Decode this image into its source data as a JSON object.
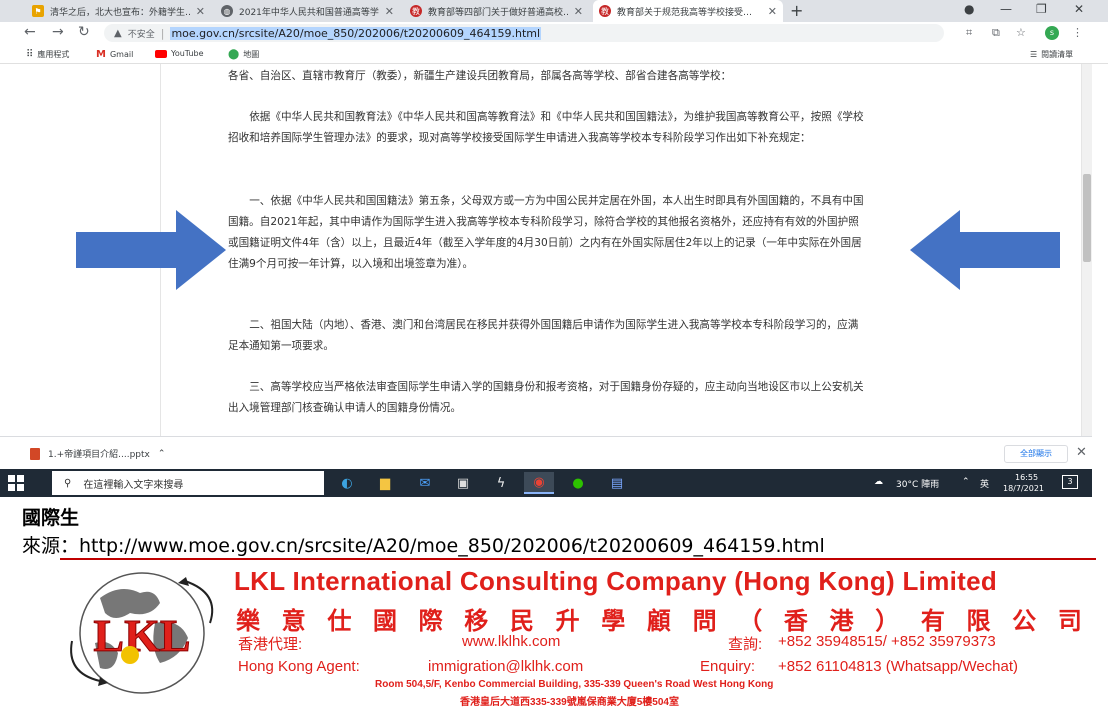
{
  "browser": {
    "tabs": [
      {
        "title": "清华之后，北大也宣布：外籍学生…",
        "favicon": "yellow-flag-icon",
        "active": false
      },
      {
        "title": "2021年中华人民共和国普通高等学…",
        "favicon": "globe-icon",
        "active": false
      },
      {
        "title": "教育部等四部门关于做好普通高校…",
        "favicon": "moe-emblem-icon",
        "active": false
      },
      {
        "title": "教育部关于规范我高等学校接受…",
        "favicon": "moe-emblem-icon",
        "active": true
      }
    ],
    "security_label": "不安全",
    "url": "moe.gov.cn/srcsite/A20/moe_850/202006/t20200609_464159.html",
    "profile_initial": "s",
    "bookmarks": [
      {
        "label": "應用程式",
        "icon": "apps-grid-icon"
      },
      {
        "label": "Gmail",
        "icon": "gmail-icon"
      },
      {
        "label": "YouTube",
        "icon": "youtube-icon"
      },
      {
        "label": "地圖",
        "icon": "maps-pin-icon"
      }
    ],
    "reading_list": "閱讀清單"
  },
  "page": {
    "paragraphs": [
      "各省、自治区、直辖市教育厅（教委），新疆生产建设兵团教育局，部属各高等学校、部省合建各高等学校：",
      "依据《中华人民共和国教育法》《中华人民共和国高等教育法》和《中华人民共和国国籍法》，为维护我国高等教育公平，按照《学校招收和培养国际学生管理办法》的要求，现对高等学校接受国际学生申请进入我高等学校本专科阶段学习作出如下补充规定：",
      "一、依据《中华人民共和国国籍法》第五条，父母双方或一方为中国公民并定居在外国，本人出生时即具有外国国籍的，不具有中国国籍。自2021年起，其中申请作为国际学生进入我高等学校本专科阶段学习，除符合学校的其他报名资格外，还应持有有效的外国护照或国籍证明文件4年（含）以上，且最近4年（截至入学年度的4月30日前）之内有在外国实际居住2年以上的记录（一年中实际在外国居住满9个月可按一年计算，以入境和出境签章为准）。",
      "二、祖国大陆（内地）、香港、澳门和台湾居民在移民并获得外国国籍后申请作为国际学生进入我高等学校本专科阶段学习的，应满足本通知第一项要求。",
      "三、高等学校应当严格依法审查国际学生申请入学的国籍身份和报考资格，对于国籍身份存疑的，应主动向当地设区市以上公安机关出入境管理部门核查确认申请人的国籍身份情况。"
    ]
  },
  "download_bar": {
    "file_name": "1.+帝謹項目介紹....pptx",
    "show_all": "全部顯示"
  },
  "taskbar": {
    "search_placeholder": "在這裡輸入文字來搜尋",
    "weather": "30°C 陣雨",
    "ime": "英",
    "time": "16:55",
    "date": "18/7/2021",
    "notifications": "3"
  },
  "caption": {
    "title": "國際生",
    "source_label": "來源：",
    "source_url": "http://www.moe.gov.cn/srcsite/A20/moe_850/202006/t20200609_464159.html"
  },
  "footer": {
    "company_en": "LKL International Consulting Company (Hong Kong) Limited",
    "company_zh_chars": [
      "樂",
      "意",
      "仕",
      "國",
      "際",
      "移",
      "民",
      "升",
      "學",
      "顧",
      "問",
      "（",
      "香",
      "港",
      "）",
      "有",
      "限",
      "公",
      "司"
    ],
    "hk_agent_zh": "香港代理:",
    "website": "www.lklhk.com",
    "enquiry_zh": "查詢:",
    "phones": "+852 35948515/ +852 35979373",
    "hk_agent_en": "Hong Kong Agent:",
    "email": "immigration@lklhk.com",
    "enquiry_en": "Enquiry:",
    "whatsapp": "+852 61104813 (Whatsapp/Wechat)",
    "address_en": "Room 504,5/F, Kenbo Commercial Building, 335-339 Queen's Road West Hong Kong",
    "address_zh": "香港皇后大道西335-339號嵐保商業大廈5樓504室",
    "logo_text": "LKL"
  }
}
